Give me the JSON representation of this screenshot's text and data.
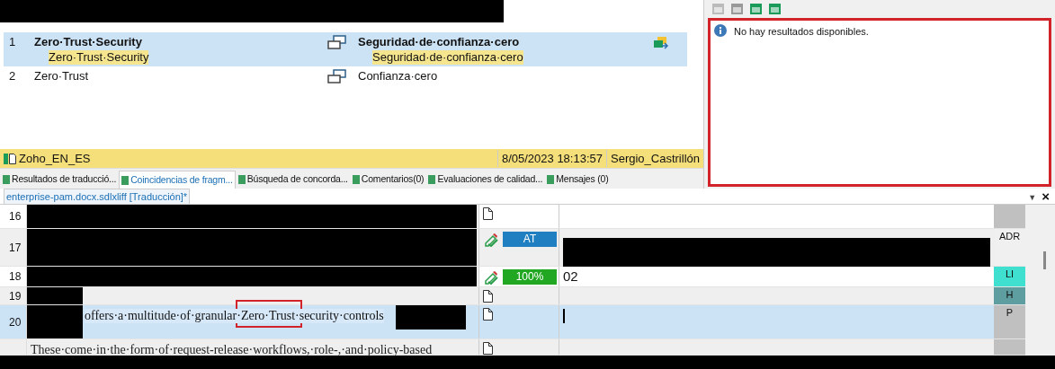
{
  "matches": [
    {
      "number": "1",
      "source": "Zero·Trust·Security",
      "source_sub": "Zero·Trust·Security",
      "target": "Seguridad·de·confianza·cero",
      "target_sub": "Seguridad·de·confianza·cero",
      "selected": true
    },
    {
      "number": "2",
      "source": "Zero·Trust",
      "target": "Confianza·cero",
      "selected": false
    }
  ],
  "match_footer": {
    "memory": "Zoho_EN_ES",
    "date": "8/05/2023 18:13:57",
    "user": "Sergio_Castrillón"
  },
  "results_panel": {
    "message": "No hay resultados disponibles."
  },
  "tabs": [
    {
      "label": "Resultados de traducció...",
      "selected": false
    },
    {
      "label": "Coincidencias de fragm...",
      "selected": true
    },
    {
      "label": "Búsqueda de concorda...",
      "selected": false
    },
    {
      "label": "Comentarios(0)",
      "selected": false
    },
    {
      "label": "Evaluaciones de calidad...",
      "selected": false
    },
    {
      "label": "Mensajes (0)",
      "selected": false
    }
  ],
  "document_tab": {
    "label": "enterprise-pam.docx.sdlxliff [Traducción]*",
    "close": "×",
    "menu": "▼"
  },
  "segments": [
    {
      "number": "16",
      "kind": "blackout",
      "status": {
        "kind": "none"
      },
      "color": "#c0c0c0",
      "selected": false
    },
    {
      "number": "17",
      "kind": "blackout",
      "target_redacted": true,
      "status": {
        "kind": "at",
        "label": "AT"
      },
      "structure": "ADR",
      "color": "#f0f0f0",
      "selected": false
    },
    {
      "number": "18",
      "kind": "blackout",
      "status": {
        "kind": "match",
        "label": "100%"
      },
      "target": "02",
      "structure": "LI",
      "color": "#40e0d0",
      "selected": false
    },
    {
      "number": "19",
      "kind": "leftmask",
      "status": {
        "kind": "none"
      },
      "structure": "H",
      "color": "#5f9ea0",
      "selected": false
    },
    {
      "number": "20",
      "kind": "splitmask",
      "source": "offers·a·multitude·of·granular·Zero·Trust·security·controls",
      "status": {
        "kind": "none"
      },
      "structure": "P",
      "color": "#c0c0c0",
      "selected": true
    },
    {
      "kind": "plain",
      "source": "These·come·in·the·form·of·request-release·workflows,·role-,·and·policy-based",
      "status": {
        "kind": "none"
      },
      "color": "#c0c0c0",
      "selected": false
    }
  ]
}
